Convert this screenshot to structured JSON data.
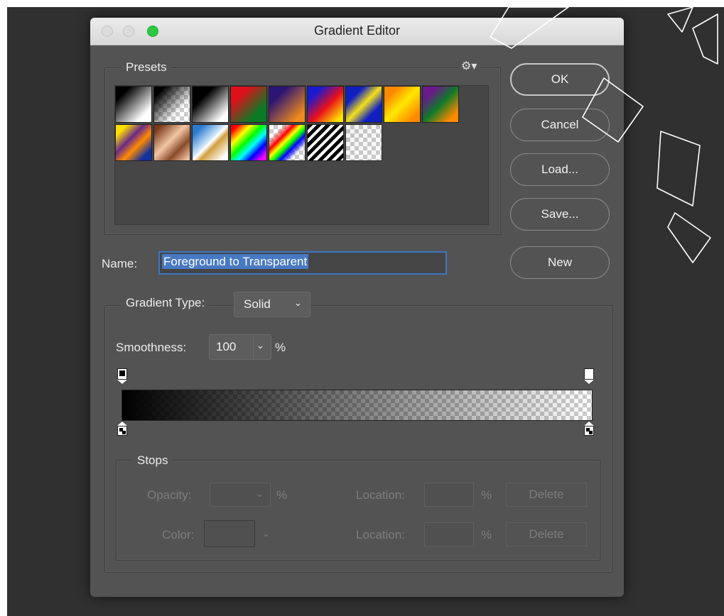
{
  "window": {
    "title": "Gradient Editor"
  },
  "presets": {
    "legend": "Presets",
    "settings_icon": "gear-icon",
    "swatches": [
      {
        "name": "foreground-to-background",
        "bg": "linear-gradient(135deg,#000 20%,#fff 80%)"
      },
      {
        "name": "foreground-to-transparent",
        "bg": "linear-gradient(135deg,#000 15%,rgba(0,0,0,0) 70%)",
        "checker": true
      },
      {
        "name": "black-white",
        "bg": "linear-gradient(135deg,#000 30%,#fff 85%)"
      },
      {
        "name": "red-green",
        "bg": "linear-gradient(135deg,#e0101a 25%,#0a7a25 75%)"
      },
      {
        "name": "violet-orange",
        "bg": "linear-gradient(135deg,#2b1575 25%,#f08a1c 85%)"
      },
      {
        "name": "blue-red-yellow",
        "bg": "linear-gradient(135deg,#1a1ad0 20%,#e8101a 55%,#ffe400 90%)"
      },
      {
        "name": "blue-yellow-blue",
        "bg": "linear-gradient(135deg,#1020c0 25%,#f5e11a 50%,#1020c0 75%)"
      },
      {
        "name": "orange-yellow-orange",
        "bg": "linear-gradient(135deg,#ff8a00 20%,#ffe800 50%,#ff8a00 85%)"
      },
      {
        "name": "violet-green-orange",
        "bg": "linear-gradient(135deg,#6a1a8a 20%,#0e7a2a 50%,#ff8a00 85%)"
      },
      {
        "name": "yellow-violet-orange-blue",
        "bg": "linear-gradient(135deg,#ffe000 15%,#6a2a8a 40%,#ff8a00 60%,#1030a0 85%)"
      },
      {
        "name": "copper",
        "bg": "linear-gradient(135deg,#7a3a1a 10%,#f3c6a5 45%,#8a4a2a 70%,#f0c0a0 95%)"
      },
      {
        "name": "chrome",
        "bg": "linear-gradient(135deg,#2a7ad0 15%,#cfe6f8 45%,#ffffff 50%,#d0a040 60%,#ffffff 90%)"
      },
      {
        "name": "spectrum",
        "bg": "linear-gradient(135deg,#ff0000 10%,#ffff00 28%,#00ff00 45%,#00ffff 60%,#0000ff 75%,#ff00ff 92%)"
      },
      {
        "name": "transparent-rainbow",
        "bg": "linear-gradient(135deg,rgba(255,255,255,0) 20%,#ff0000 35%,#ffff00 45%,#00ff00 55%,#0000ff 65%,rgba(255,255,255,0) 80%)",
        "checker": true
      },
      {
        "name": "transparent-stripes",
        "bg": "repeating-linear-gradient(135deg,#000 0 5px,#fff 5px 9px)"
      },
      {
        "name": "neutral-density",
        "bg": "linear-gradient(135deg,rgba(0,0,0,0.05),rgba(0,0,0,0.0))",
        "checker": true
      }
    ]
  },
  "buttons": {
    "ok": "OK",
    "cancel": "Cancel",
    "load": "Load...",
    "save": "Save...",
    "new": "New"
  },
  "name": {
    "label": "Name:",
    "value": "Foreground to Transparent"
  },
  "gradient": {
    "type_label": "Gradient Type:",
    "type_value": "Solid",
    "smoothness_label": "Smoothness:",
    "smoothness_value": "100",
    "smoothness_unit": "%",
    "start_color": "#000000",
    "end_color": "#000000"
  },
  "stops": {
    "legend": "Stops",
    "opacity_label": "Opacity:",
    "opacity_unit": "%",
    "color_label": "Color:",
    "location_label": "Location:",
    "location_unit": "%",
    "delete_label": "Delete"
  }
}
